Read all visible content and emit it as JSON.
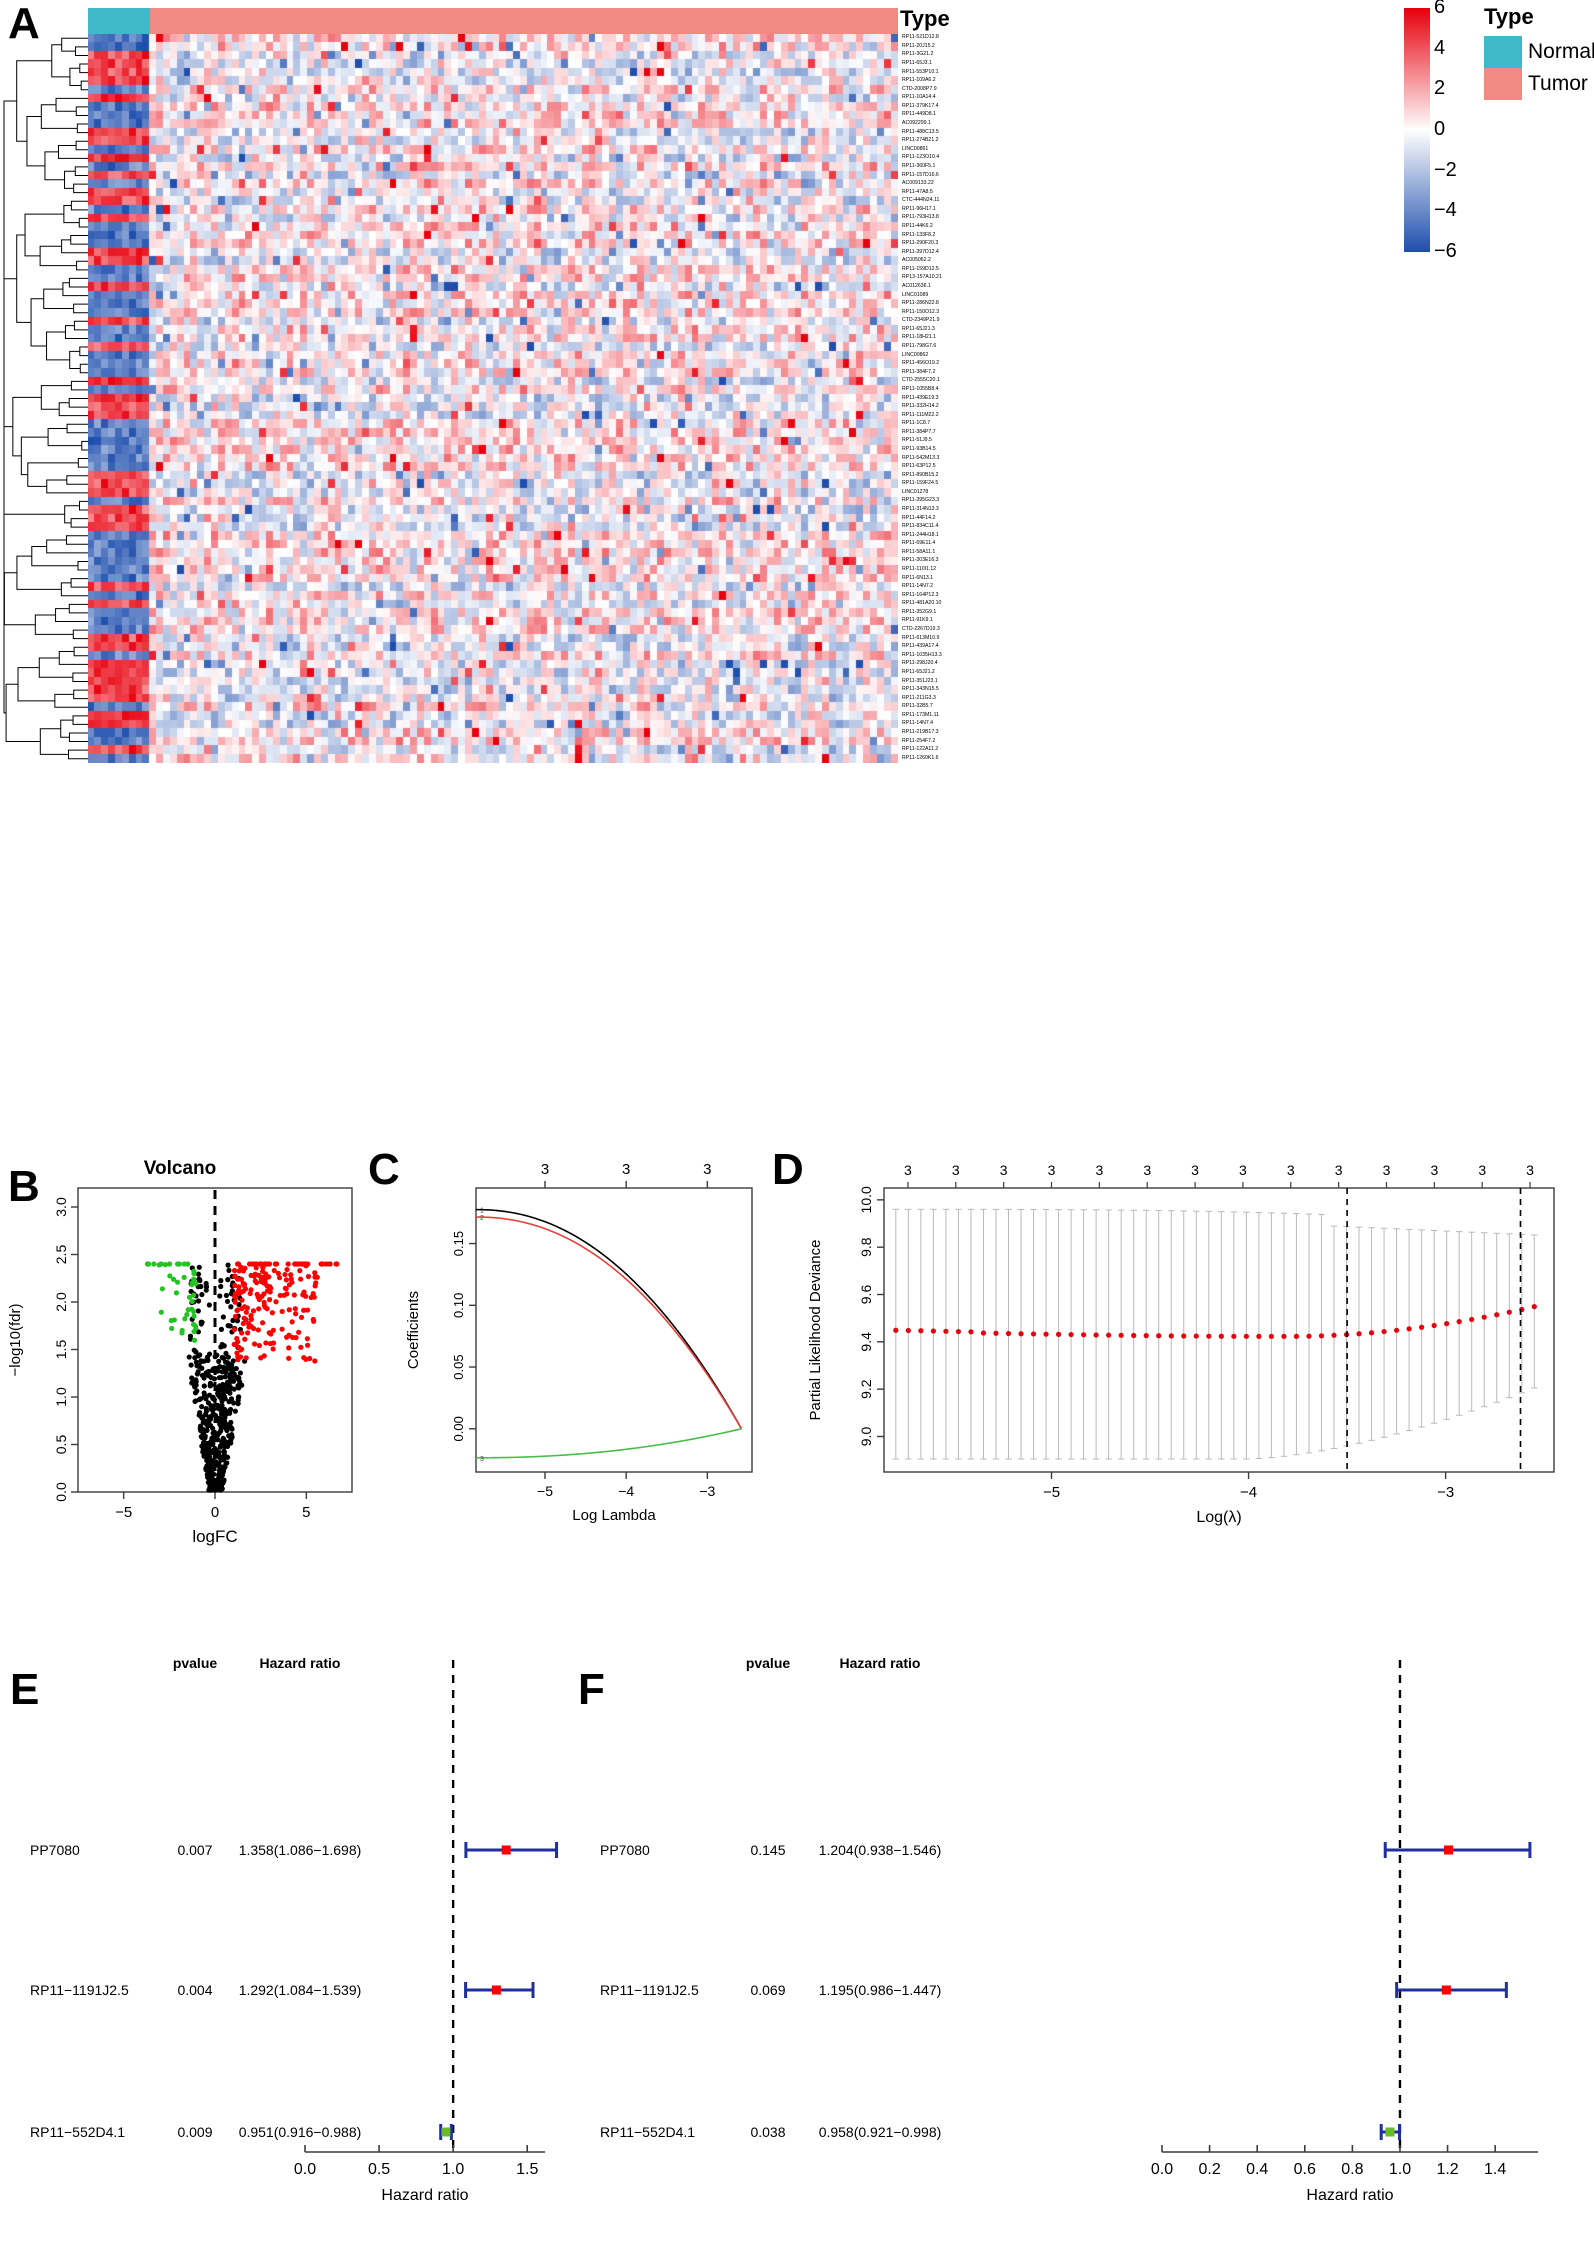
{
  "figure": {
    "panels": [
      "A",
      "B",
      "C",
      "D",
      "E",
      "F"
    ]
  },
  "panelA": {
    "letter": "A",
    "annotation_title": "Type",
    "legend_title": "Type",
    "legend_items": [
      {
        "label": "Normal",
        "color": "#3fb9c8"
      },
      {
        "label": "Tumor",
        "color": "#f08a82"
      }
    ],
    "colorbar": {
      "ticks": [
        "6",
        "4",
        "2",
        "0",
        "-2",
        "-4",
        "-6"
      ],
      "high_color": "#e8000d",
      "mid_color": "#ffffff",
      "low_color": "#1f4fae",
      "min": -6,
      "max": 6
    },
    "row_labels": [
      "RP11-521D12.8",
      "RP11-20J15.2",
      "RP11-3G21.2",
      "RP11-65J3.1",
      "RP11-553P10.1",
      "RP11-109A6.2",
      "CTD-2008P7.9",
      "RP11-10A14.4",
      "RP11-379K17.4",
      "RP11-449D8.1",
      "AC092299.1",
      "RP11-488C13.5",
      "RP11-274B21.2",
      "LINC00861",
      "RP11-123O10.4",
      "RP11-360F5.1",
      "RP11-157D16.6",
      "AC009133.22",
      "RP11-47A8.5",
      "CTC-444N24.11",
      "RP11-96H17.1",
      "RP11-793H13.8",
      "RP11-44K6.2",
      "RP11-133F8.2",
      "RP11-290F20.3",
      "RP11-397D12.4",
      "AC005062.2",
      "RP11-159D12.5",
      "RP13-157A10.21",
      "AC012636.1",
      "LINC01089",
      "RP11-286N22.8",
      "RP11-150O12.3",
      "CTD-2349P21.9",
      "RP11-65J21.3",
      "RP11-18H21.1",
      "RP11-798G7.6",
      "LINC00862",
      "RP11-456O19.2",
      "RP11-384F7.2",
      "CTD-2555C20.1",
      "RP11-1055B8.4",
      "RP11-439E19.3",
      "RP11-332H14.2",
      "RP11-111M22.2",
      "RP11-1C8.7",
      "RP11-384P7.7",
      "RP11-51J9.5",
      "RP11-93B14.5",
      "RP11-542M13.3",
      "RP11-63P12.5",
      "RP11-890B15.2",
      "RP11-159F24.5",
      "LINC01278",
      "RP11-395G23.3",
      "RP11-314N13.3",
      "RP11-44F14.2",
      "RP11-834C11.4",
      "RP11-244H18.1",
      "RP11-69E11.4",
      "RP11-58A11.1",
      "RP11-303E16.3",
      "RP11-110I1.12",
      "RP11-6N13.1",
      "RP11-14N7.2",
      "RP11-164P12.3",
      "RP11-481A20.10",
      "RP11-352G9.1",
      "RP11-91K9.1",
      "CTD-2267D19.3",
      "RP11-613M10.9",
      "RP11-439A17.4",
      "RP11-1035H13.3",
      "RP11-298J20.4",
      "RP11-65J21.2",
      "RP11-351J23.1",
      "RP11-343N15.5",
      "RP11-211G3.3",
      "RP11-32B5.7",
      "RP11-173M1.11",
      "RP11-14N7.4",
      "RP11-219B17.3",
      "RP11-254F7.2",
      "RP11-122A11.2",
      "RP11-1260K1.6"
    ],
    "n_samples": 118,
    "n_normal": 9,
    "n_tumor": 109,
    "n_rows": 85
  },
  "panelB": {
    "letter": "B",
    "title": "Volcano",
    "xlabel": "logFC",
    "ylabel": "-log10(fdr)",
    "x_ticks": [
      "-5",
      "0",
      "5"
    ],
    "y_ticks": [
      "0.0",
      "0.5",
      "1.0",
      "1.5",
      "2.0",
      "2.5",
      "3.0"
    ],
    "xlim": [
      -7.5,
      7.5
    ],
    "ylim": [
      0.0,
      3.2
    ],
    "colors": {
      "up": "#ff0000",
      "down": "#22c422",
      "ns": "#000000"
    },
    "threshold_line_x": 0
  },
  "panelC": {
    "letter": "C",
    "xlabel": "Log Lambda",
    "ylabel": "Coefficients",
    "x_ticks": [
      "-5",
      "-4",
      "-3"
    ],
    "y_ticks": [
      "0.00",
      "0.05",
      "0.10",
      "0.15"
    ],
    "top_axis_ticks": [
      "3",
      "3",
      "3"
    ],
    "xlim": [
      -5.85,
      -2.45
    ],
    "ylim": [
      -0.035,
      0.195
    ],
    "series": [
      {
        "name": "1",
        "color": "#000000",
        "label": "1"
      },
      {
        "name": "2",
        "color": "#e8403a",
        "label": "2"
      },
      {
        "name": "3",
        "color": "#4cbb4c",
        "label": "3"
      }
    ]
  },
  "panelD": {
    "letter": "D",
    "xlabel": "Log(λ)",
    "ylabel": "Partial Likelihood Deviance",
    "x_ticks": [
      "-5",
      "-4",
      "-3"
    ],
    "y_ticks": [
      "9.0",
      "9.2",
      "9.4",
      "9.6",
      "9.8",
      "10.0"
    ],
    "top_axis_ticks": [
      "3",
      "3",
      "3",
      "3",
      "3",
      "3",
      "3",
      "3",
      "3",
      "3",
      "3",
      "3",
      "3",
      "3"
    ],
    "xlim": [
      -5.85,
      -2.45
    ],
    "ylim": [
      8.85,
      10.05
    ],
    "point_color": "#e8000d",
    "vline_lambda_min": -3.5,
    "vline_lambda_1se": -2.62
  },
  "panelE": {
    "letter": "E",
    "headers": {
      "pvalue": "pvalue",
      "hazard_ratio": "Hazard ratio"
    },
    "xlabel": "Hazard ratio",
    "x_ticks": [
      "0.0",
      "0.5",
      "1.0",
      "1.5"
    ],
    "xlim": [
      0.0,
      1.62
    ],
    "reference_line": 1.0,
    "rows": [
      {
        "gene": "PP7080",
        "pvalue": "0.007",
        "hr_text": "1.358(1.086-1.698)",
        "hr": 1.358,
        "lower": 1.086,
        "upper": 1.698,
        "color": "#ff0000"
      },
      {
        "gene": "RP11-1191J2.5",
        "pvalue": "0.004",
        "hr_text": "1.292(1.084-1.539)",
        "hr": 1.292,
        "lower": 1.084,
        "upper": 1.539,
        "color": "#ff0000"
      },
      {
        "gene": "RP11-552D4.1",
        "pvalue": "0.009",
        "hr_text": "0.951(0.916-0.988)",
        "hr": 0.951,
        "lower": 0.916,
        "upper": 0.988,
        "color": "#6aba2a"
      }
    ]
  },
  "panelF": {
    "letter": "F",
    "headers": {
      "pvalue": "pvalue",
      "hazard_ratio": "Hazard ratio"
    },
    "xlabel": "Hazard ratio",
    "x_ticks": [
      "0.0",
      "0.2",
      "0.4",
      "0.6",
      "0.8",
      "1.0",
      "1.2",
      "1.4"
    ],
    "xlim": [
      0.0,
      1.58
    ],
    "reference_line": 1.0,
    "rows": [
      {
        "gene": "PP7080",
        "pvalue": "0.145",
        "hr_text": "1.204(0.938-1.546)",
        "hr": 1.204,
        "lower": 0.938,
        "upper": 1.546,
        "color": "#ff0000"
      },
      {
        "gene": "RP11-1191J2.5",
        "pvalue": "0.069",
        "hr_text": "1.195(0.986-1.447)",
        "hr": 1.195,
        "lower": 0.986,
        "upper": 1.447,
        "color": "#ff0000"
      },
      {
        "gene": "RP11-552D4.1",
        "pvalue": "0.038",
        "hr_text": "0.958(0.921-0.998)",
        "hr": 0.958,
        "lower": 0.921,
        "upper": 0.998,
        "color": "#6aba2a"
      }
    ]
  }
}
